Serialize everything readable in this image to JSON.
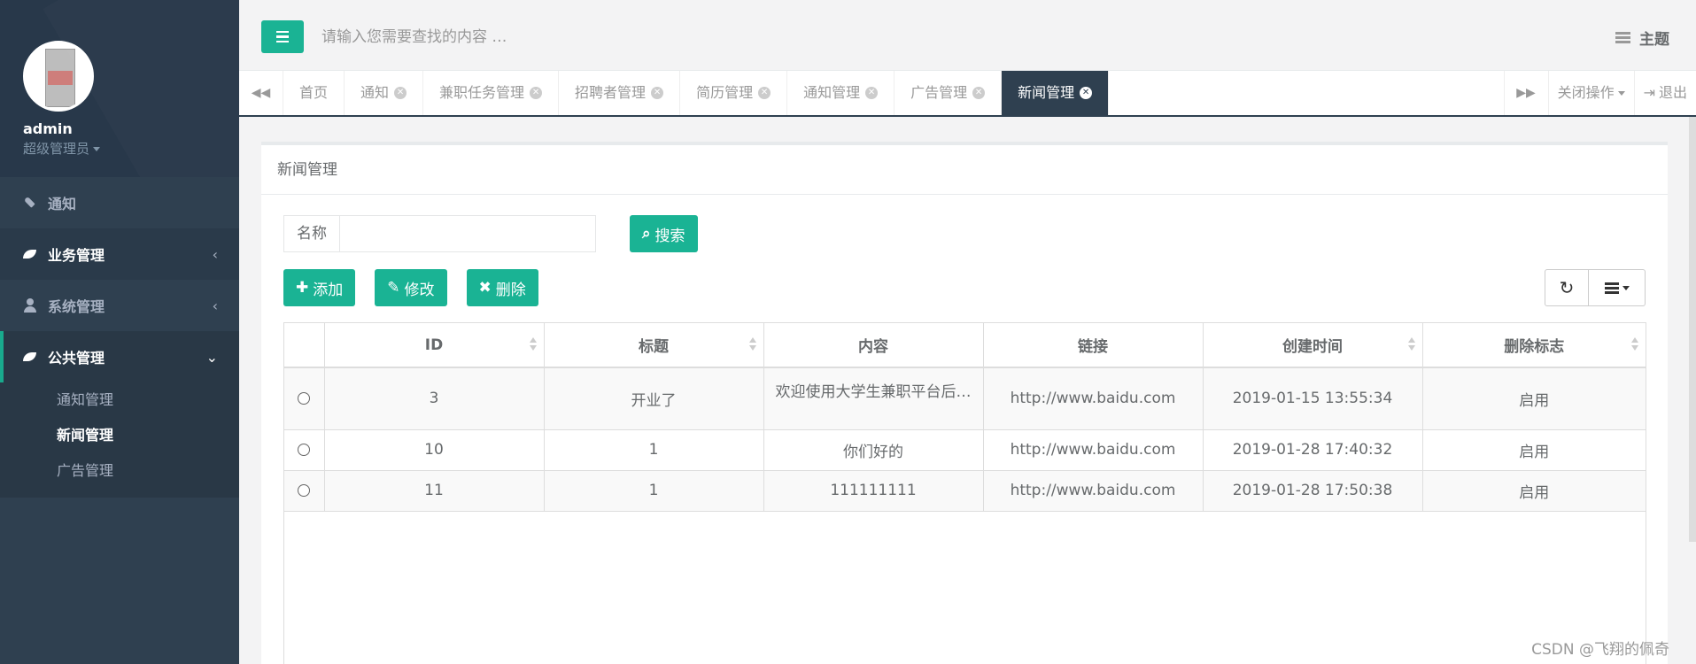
{
  "sidebar": {
    "username": "admin",
    "role": "超级管理员",
    "menu": [
      {
        "label": "通知",
        "icon": "rocket-icon"
      },
      {
        "label": "业务管理",
        "icon": "leaf-icon",
        "arrow": "‹"
      },
      {
        "label": "系统管理",
        "icon": "user-icon",
        "arrow": "‹"
      },
      {
        "label": "公共管理",
        "icon": "leaf-icon",
        "arrow": "⌄"
      }
    ],
    "submenu": [
      "通知管理",
      "新闻管理",
      "广告管理"
    ]
  },
  "topbar": {
    "search_placeholder": "请输入您需要查找的内容 …",
    "theme_label": "主题"
  },
  "tabs": {
    "items": [
      "首页",
      "通知",
      "兼职任务管理",
      "招聘者管理",
      "简历管理",
      "通知管理",
      "广告管理",
      "新闻管理"
    ],
    "active_index": 7,
    "close_action": "关闭操作",
    "logout": "退出"
  },
  "panel": {
    "title": "新闻管理",
    "name_label": "名称",
    "name_value": "",
    "search_label": "搜索",
    "add_label": "添加",
    "edit_label": "修改",
    "delete_label": "删除"
  },
  "table": {
    "headers": [
      "ID",
      "标题",
      "内容",
      "链接",
      "创建时间",
      "删除标志"
    ],
    "rows": [
      [
        "3",
        "开业了",
        "欢迎使用大学生兼职平台后…",
        "http://www.baidu.com",
        "2019-01-15 13:55:34",
        "启用"
      ],
      [
        "10",
        "1",
        "你们好的",
        "http://www.baidu.com",
        "2019-01-28 17:40:32",
        "启用"
      ],
      [
        "11",
        "1",
        "111111111",
        "http://www.baidu.com",
        "2019-01-28 17:50:38",
        "启用"
      ]
    ]
  },
  "watermark": "CSDN @飞翔的佩奇",
  "colors": {
    "accent": "#1ab394",
    "sidebar": "#2f4050"
  }
}
